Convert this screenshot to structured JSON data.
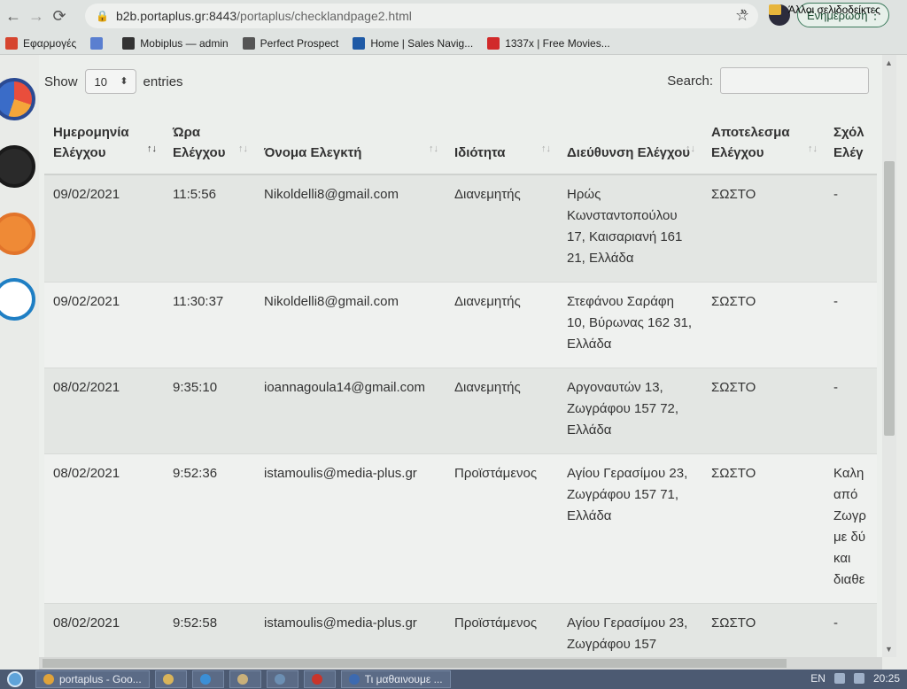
{
  "browser": {
    "url_host": "b2b.portaplus.gr:8443",
    "url_path": "/portaplus/checklandpage2.html",
    "update_label": "Ενημέρωση"
  },
  "bookmarks": [
    {
      "label": "Εφαρμογές",
      "color": "#d6452f"
    },
    {
      "label": "",
      "color": "#5a7fd0"
    },
    {
      "label": "Mobiplus — admin",
      "color": "#333333"
    },
    {
      "label": "Perfect Prospect",
      "color": "#555555"
    },
    {
      "label": "Home | Sales Navig...",
      "color": "#1f5aa6"
    },
    {
      "label": "1337x | Free Movies...",
      "color": "#d12a2a"
    }
  ],
  "bookmarks_more": "»",
  "bookmarks_other": "Άλλοι σελιδοδείκτες",
  "controls": {
    "show_label": "Show",
    "entries_value": "10",
    "entries_label": "entries",
    "search_label": "Search:"
  },
  "table": {
    "headers": [
      "Ημερομηνία Ελέγχου",
      "Ώρα Ελέγχου",
      "Όνομα Ελεγκτή",
      "Ιδιότητα",
      "Διεύθυνση Ελέγχου",
      "Αποτελεσμα Ελέγχου",
      "Σχόλ Ελέγ"
    ],
    "rows": [
      [
        "09/02/2021",
        "11:5:56",
        "Nikoldelli8@gmail.com",
        "Διανεμητής",
        "Ηρώς Κωνσταντοπούλου 17, Καισαριανή 161 21, Ελλάδα",
        "ΣΩΣΤΟ",
        "-"
      ],
      [
        "09/02/2021",
        "11:30:37",
        "Nikoldelli8@gmail.com",
        "Διανεμητής",
        "Στεφάνου Σαράφη 10, Βύρωνας 162 31, Ελλάδα",
        "ΣΩΣΤΟ",
        "-"
      ],
      [
        "08/02/2021",
        "9:35:10",
        "ioannagoula14@gmail.com",
        "Διανεμητής",
        "Αργοναυτών 13, Ζωγράφου 157 72, Ελλάδα",
        "ΣΩΣΤΟ",
        "-"
      ],
      [
        "08/02/2021",
        "9:52:36",
        "istamoulis@media-plus.gr",
        "Προϊστάμενος",
        "Αγίου Γερασίμου 23, Ζωγράφου 157 71, Ελλάδα",
        "ΣΩΣΤΟ",
        "Καλη από Ζωγρ με δύ και διαθε"
      ],
      [
        "08/02/2021",
        "9:52:58",
        "istamoulis@media-plus.gr",
        "Προϊστάμενος",
        "Αγίου Γερασίμου 23, Ζωγράφου 157",
        "ΣΩΣΤΟ",
        "-"
      ]
    ]
  },
  "taskbar": {
    "tasks": [
      {
        "label": "portaplus - Goo...",
        "color": "#e0a33a"
      },
      {
        "label": "",
        "color": "#d9b45a"
      },
      {
        "label": "",
        "color": "#3b8fd6"
      },
      {
        "label": "",
        "color": "#c9b07a"
      },
      {
        "label": "",
        "color": "#6c8fb3"
      },
      {
        "label": "",
        "color": "#c9352b"
      },
      {
        "label": "Τι μαθαινουμε ...",
        "color": "#3d6ab0"
      }
    ],
    "lang": "EN",
    "time": "20:25"
  }
}
